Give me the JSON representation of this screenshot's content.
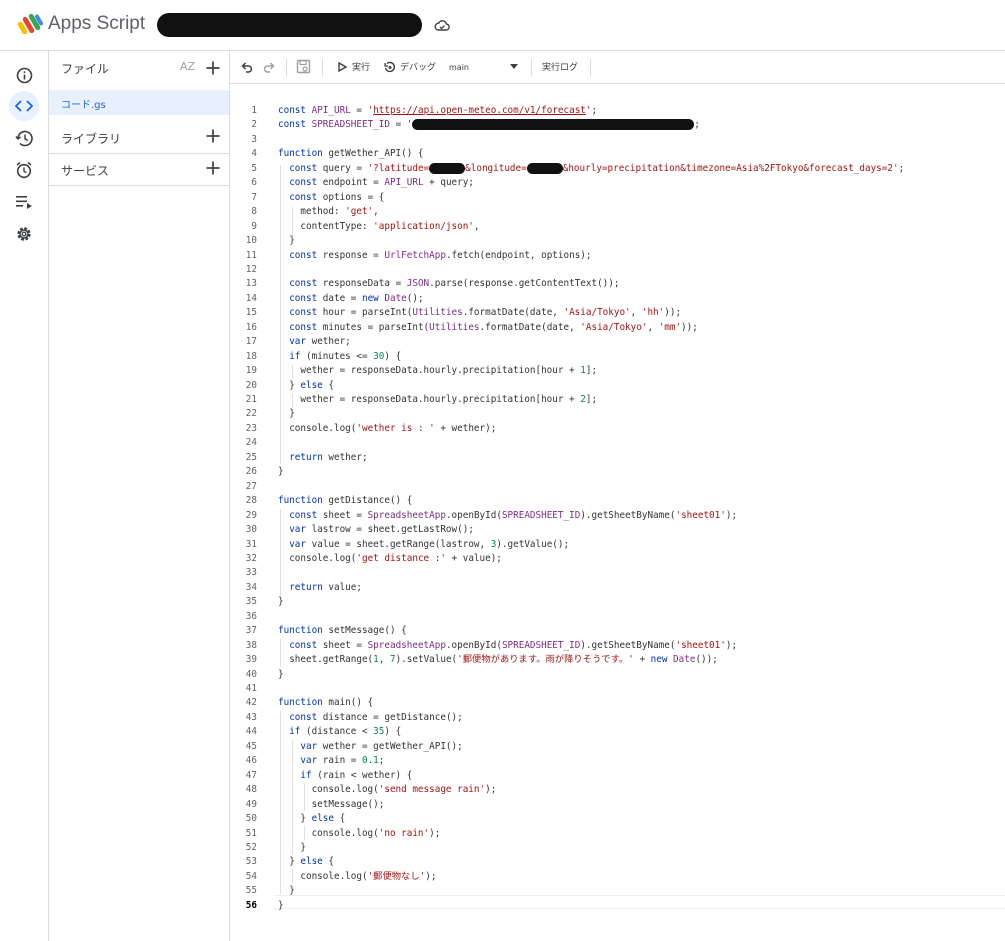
{
  "header": {
    "app_title": "Apps Script"
  },
  "files_panel": {
    "files_label": "ファイル",
    "sort_label": "AZ",
    "file_name": "コード.gs",
    "libraries_label": "ライブラリ",
    "services_label": "サービス"
  },
  "toolbar": {
    "run_label": "実行",
    "debug_label": "デバッグ",
    "function_select": "main",
    "log_label": "実行ログ"
  },
  "editor": {
    "current_line": "56",
    "lines": [
      {
        "n": "1",
        "h": "<span class='k'>const</span> <span class='g'>API_URL</span> = <span class='s'>'</span><span class='lnk'>https://api.open-meteo.com/v1/forecast</span><span class='s'>'</span>;"
      },
      {
        "n": "2",
        "h": "<span class='k'>const</span> <span class='g'>SPREADSHEET_ID</span> = <span class='s'>'</span><span class='rd' style='display:inline-block;width:282px;height:11px;background:#111;border-radius:6px;vertical-align:middle'></span>;"
      },
      {
        "n": "3",
        "h": ""
      },
      {
        "n": "4",
        "h": "<span class='k'>function</span> getWether_API() {"
      },
      {
        "n": "5",
        "h": "  <span class='k'>const</span> query = <span class='s'>'?latitude=</span><span style='display:inline-block;width:36px;height:11px;background:#111;border-radius:6px;vertical-align:middle'></span><span class='s'>&amp;longitude=</span><span style='display:inline-block;width:36px;height:11px;background:#111;border-radius:6px;vertical-align:middle'></span><span class='s'>&amp;hourly=precipitation&amp;timezone=Asia%2FTokyo&amp;forecast_days=2'</span>;"
      },
      {
        "n": "6",
        "h": "  <span class='k'>const</span> endpoint = <span class='g'>API_URL</span> + query;"
      },
      {
        "n": "7",
        "h": "  <span class='k'>const</span> options = {"
      },
      {
        "n": "8",
        "h": "    method: <span class='s'>'get'</span>,"
      },
      {
        "n": "9",
        "h": "    contentType: <span class='s'>'application/json'</span>,"
      },
      {
        "n": "10",
        "h": "  }"
      },
      {
        "n": "11",
        "h": "  <span class='k'>const</span> response = <span class='g'>UrlFetchApp</span>.fetch(endpoint, options);"
      },
      {
        "n": "12",
        "h": ""
      },
      {
        "n": "13",
        "h": "  <span class='k'>const</span> responseData = <span class='g'>JSON</span>.parse(response.getContentText());"
      },
      {
        "n": "14",
        "h": "  <span class='k'>const</span> date = <span class='k'>new</span> <span class='g'>Date</span>();"
      },
      {
        "n": "15",
        "h": "  <span class='k'>const</span> hour = parseInt(<span class='g'>Utilities</span>.formatDate(date, <span class='s'>'Asia/Tokyo'</span>, <span class='s'>'hh'</span>));"
      },
      {
        "n": "16",
        "h": "  <span class='k'>const</span> minutes = parseInt(<span class='g'>Utilities</span>.formatDate(date, <span class='s'>'Asia/Tokyo'</span>, <span class='s'>'mm'</span>));"
      },
      {
        "n": "17",
        "h": "  <span class='k'>var</span> wether;"
      },
      {
        "n": "18",
        "h": "  <span class='k'>if</span> (minutes &lt;= <span class='n'>30</span>) {"
      },
      {
        "n": "19",
        "h": "    wether = responseData.hourly.precipitation[hour + <span class='n'>1</span>];"
      },
      {
        "n": "20",
        "h": "  } <span class='k'>else</span> {"
      },
      {
        "n": "21",
        "h": "    wether = responseData.hourly.precipitation[hour + <span class='n'>2</span>];"
      },
      {
        "n": "22",
        "h": "  }"
      },
      {
        "n": "23",
        "h": "  console.log(<span class='s'>'wether is : '</span> + wether);"
      },
      {
        "n": "24",
        "h": ""
      },
      {
        "n": "25",
        "h": "  <span class='k'>return</span> wether;"
      },
      {
        "n": "26",
        "h": "}"
      },
      {
        "n": "27",
        "h": ""
      },
      {
        "n": "28",
        "h": "<span class='k'>function</span> getDistance() {"
      },
      {
        "n": "29",
        "h": "  <span class='k'>const</span> sheet = <span class='g'>SpreadsheetApp</span>.openById(<span class='g'>SPREADSHEET_ID</span>).getSheetByName(<span class='s'>'sheet01'</span>);"
      },
      {
        "n": "30",
        "h": "  <span class='k'>var</span> lastrow = sheet.getLastRow();"
      },
      {
        "n": "31",
        "h": "  <span class='k'>var</span> value = sheet.getRange(lastrow, <span class='n'>3</span>).getValue();"
      },
      {
        "n": "32",
        "h": "  console.log(<span class='s'>'get distance :'</span> + value);"
      },
      {
        "n": "33",
        "h": ""
      },
      {
        "n": "34",
        "h": "  <span class='k'>return</span> value;"
      },
      {
        "n": "35",
        "h": "}"
      },
      {
        "n": "36",
        "h": ""
      },
      {
        "n": "37",
        "h": "<span class='k'>function</span> setMessage() {"
      },
      {
        "n": "38",
        "h": "  <span class='k'>const</span> sheet = <span class='g'>SpreadsheetApp</span>.openById(<span class='g'>SPREADSHEET_ID</span>).getSheetByName(<span class='s'>'sheet01'</span>);"
      },
      {
        "n": "39",
        "h": "  sheet.getRange(<span class='n'>1</span>, <span class='n'>7</span>).setValue(<span class='s'>'郵便物があります。雨が降りそうです。'</span> + <span class='k'>new</span> <span class='g'>Date</span>());"
      },
      {
        "n": "40",
        "h": "}"
      },
      {
        "n": "41",
        "h": ""
      },
      {
        "n": "42",
        "h": "<span class='k'>function</span> main() {"
      },
      {
        "n": "43",
        "h": "  <span class='k'>const</span> distance = getDistance();"
      },
      {
        "n": "44",
        "h": "  <span class='k'>if</span> (distance &lt; <span class='n'>35</span>) {"
      },
      {
        "n": "45",
        "h": "    <span class='k'>var</span> wether = getWether_API();"
      },
      {
        "n": "46",
        "h": "    <span class='k'>var</span> rain = <span class='n'>0.1</span>;"
      },
      {
        "n": "47",
        "h": "    <span class='k'>if</span> (rain &lt; wether) {"
      },
      {
        "n": "48",
        "h": "      console.log(<span class='s'>'send message rain'</span>);"
      },
      {
        "n": "49",
        "h": "      setMessage();"
      },
      {
        "n": "50",
        "h": "    } <span class='k'>else</span> {"
      },
      {
        "n": "51",
        "h": "      console.log(<span class='s'>'no rain'</span>);"
      },
      {
        "n": "52",
        "h": "    }"
      },
      {
        "n": "53",
        "h": "  } <span class='k'>else</span> {"
      },
      {
        "n": "54",
        "h": "    console.log(<span class='s'>'郵便物なし'</span>);"
      },
      {
        "n": "55",
        "h": "  }"
      },
      {
        "n": "56",
        "h": "}"
      }
    ]
  }
}
